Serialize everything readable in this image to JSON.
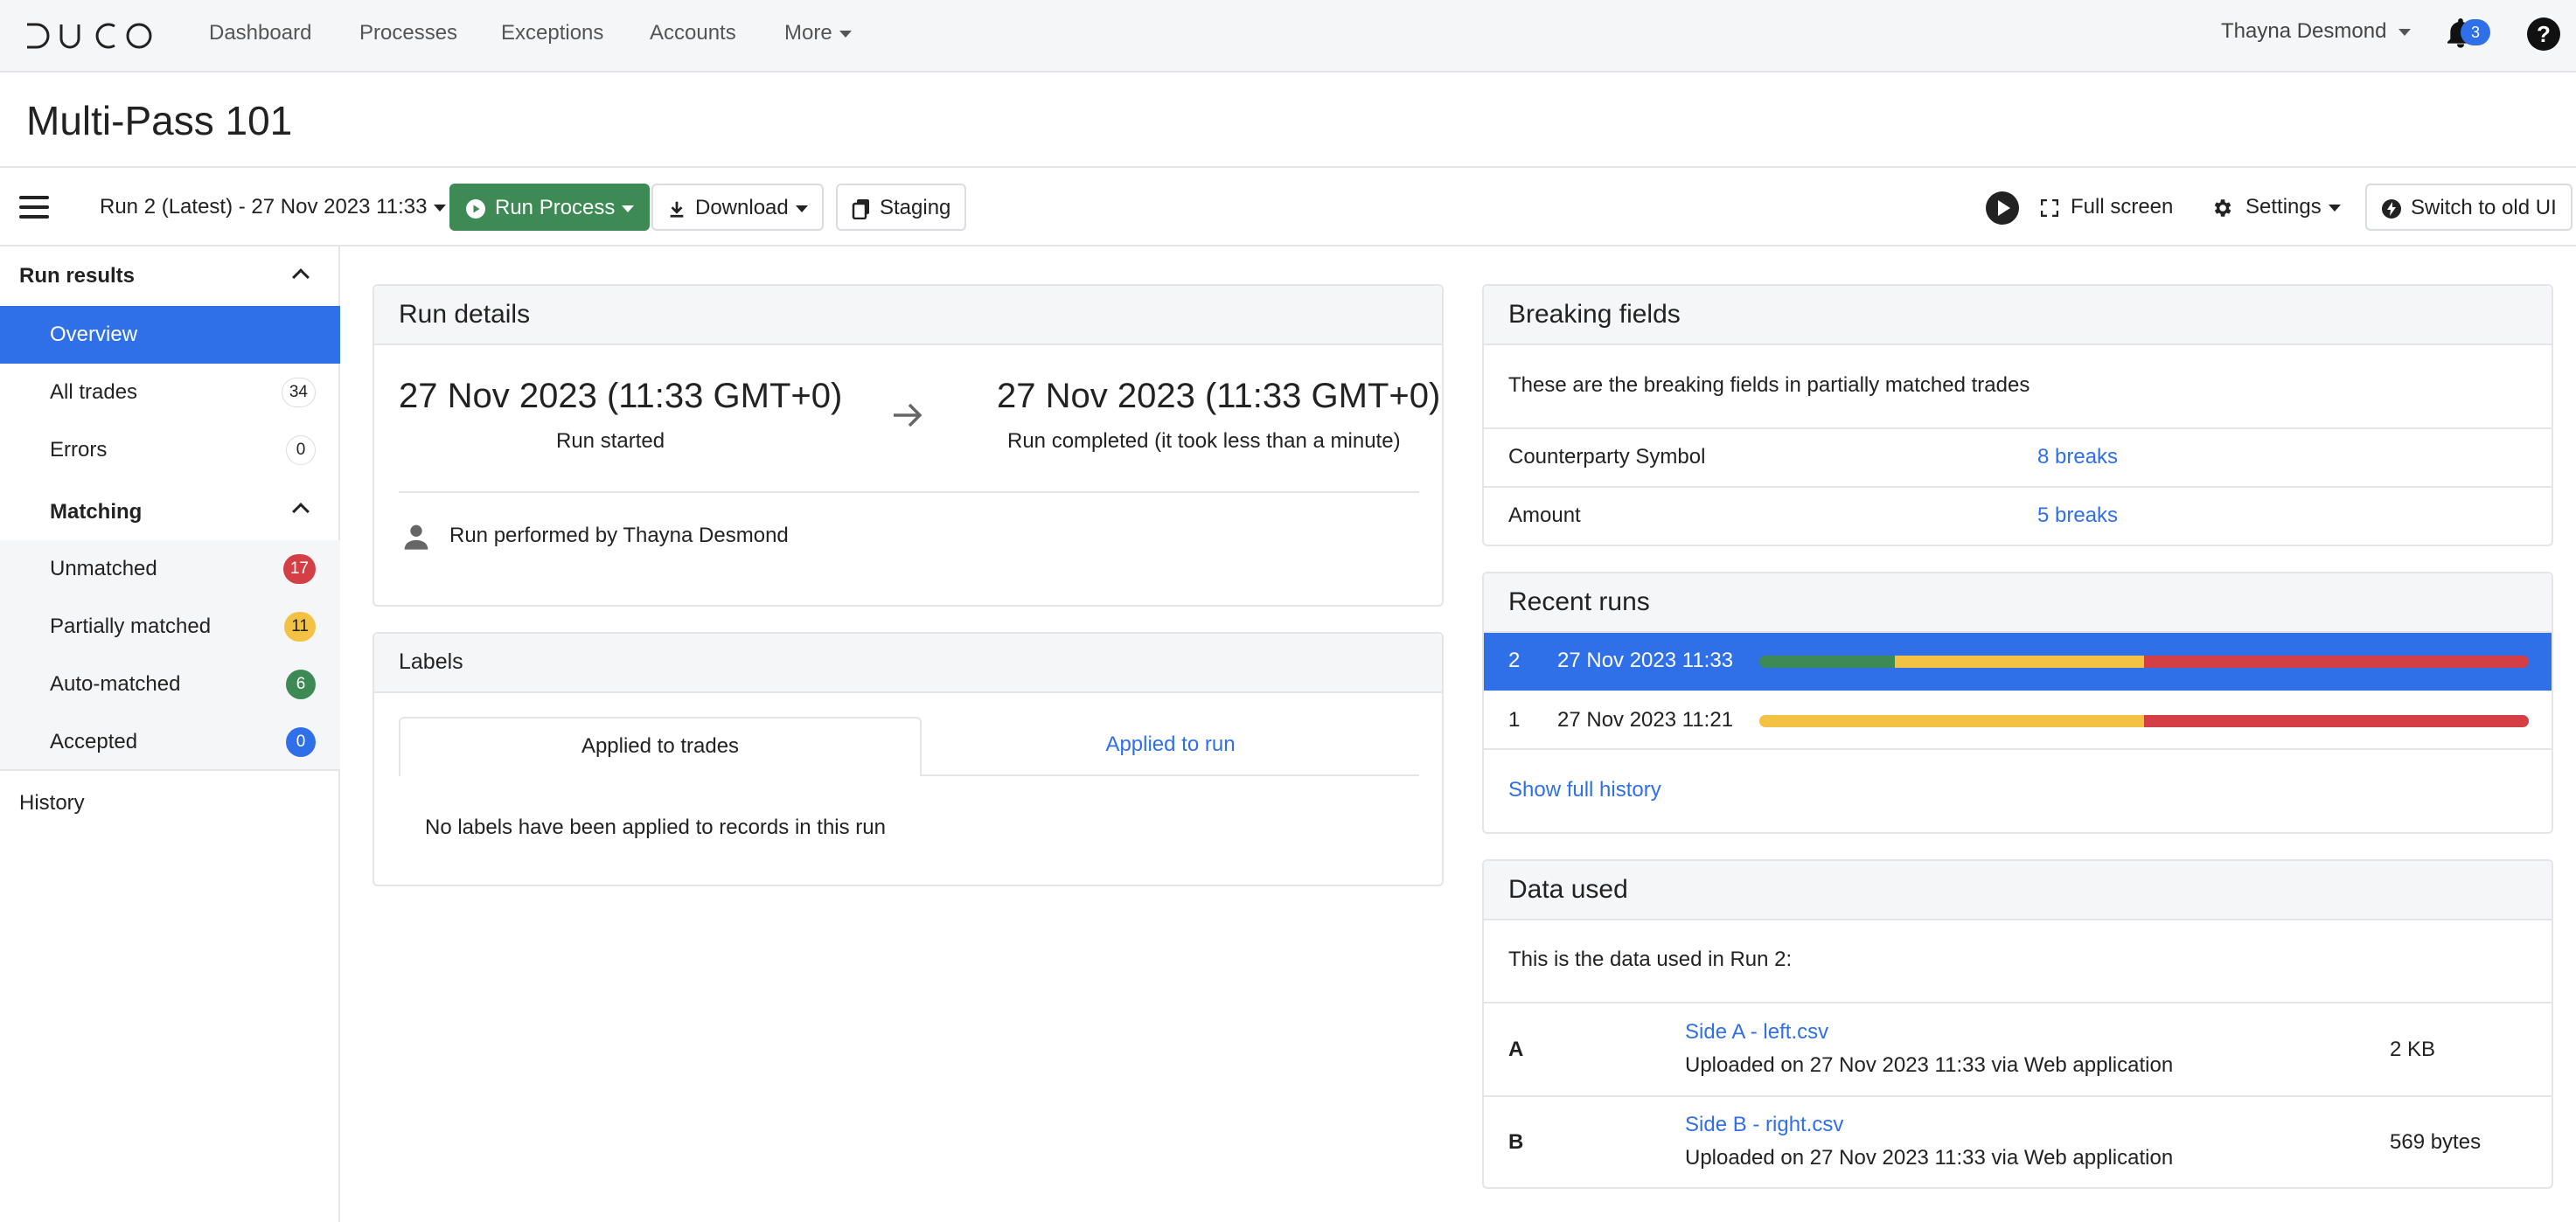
{
  "nav": {
    "logo_text": "DUCO",
    "items": [
      "Dashboard",
      "Processes",
      "Exceptions",
      "Accounts",
      "More"
    ],
    "user": "Thayna Desmond",
    "notification_count": "3",
    "help": "?"
  },
  "page": {
    "title": "Multi-Pass 101"
  },
  "toolbar": {
    "run_select": "Run 2 (Latest) - 27 Nov 2023 11:33",
    "run_process": "Run Process",
    "download": "Download",
    "staging": "Staging",
    "full_screen": "Full screen",
    "settings": "Settings",
    "switch_old_ui": "Switch to old UI"
  },
  "sidebar": {
    "run_results": "Run results",
    "overview": "Overview",
    "all_trades": "All trades",
    "all_trades_count": "34",
    "errors": "Errors",
    "errors_count": "0",
    "matching": "Matching",
    "unmatched": "Unmatched",
    "unmatched_count": "17",
    "partially_matched": "Partially matched",
    "partially_matched_count": "11",
    "auto_matched": "Auto-matched",
    "auto_matched_count": "6",
    "accepted": "Accepted",
    "accepted_count": "0",
    "history": "History"
  },
  "run_details": {
    "title": "Run details",
    "start_time": "27 Nov 2023 (11:33 GMT+0)",
    "start_label": "Run started",
    "end_time": "27 Nov 2023 (11:33 GMT+0)",
    "end_label": "Run completed (it took less than a minute)",
    "performed_by": "Run performed by Thayna Desmond"
  },
  "labels": {
    "title": "Labels",
    "tab_trades": "Applied to trades",
    "tab_run": "Applied to run",
    "empty": "No labels have been applied to records in this run"
  },
  "breaking_fields": {
    "title": "Breaking fields",
    "description": "These are the breaking fields in partially matched trades",
    "rows": [
      {
        "field": "Counterparty Symbol",
        "breaks": "8 breaks"
      },
      {
        "field": "Amount",
        "breaks": "5 breaks"
      }
    ]
  },
  "recent_runs": {
    "title": "Recent runs",
    "runs": [
      {
        "num": "2",
        "date": "27 Nov 2023 11:33",
        "auto_matched": 6,
        "partially_matched": 11,
        "unmatched": 17
      },
      {
        "num": "1",
        "date": "27 Nov 2023 11:21",
        "auto_matched": 0,
        "partially_matched": 11,
        "unmatched": 11
      }
    ],
    "show_full_history": "Show full history"
  },
  "data_used": {
    "title": "Data used",
    "description": "This is the data used in Run 2:",
    "files": [
      {
        "side": "A",
        "name": "Side A - left.csv",
        "uploaded": "Uploaded on 27 Nov 2023 11:33 via Web application",
        "size": "2 KB"
      },
      {
        "side": "B",
        "name": "Side B - right.csv",
        "uploaded": "Uploaded on 27 Nov 2023 11:33 via Web application",
        "size": "569 bytes"
      }
    ]
  },
  "colors": {
    "accent": "#2f6fe8",
    "green": "#3d8a55",
    "yellow": "#f3c244",
    "red": "#d33f45"
  }
}
